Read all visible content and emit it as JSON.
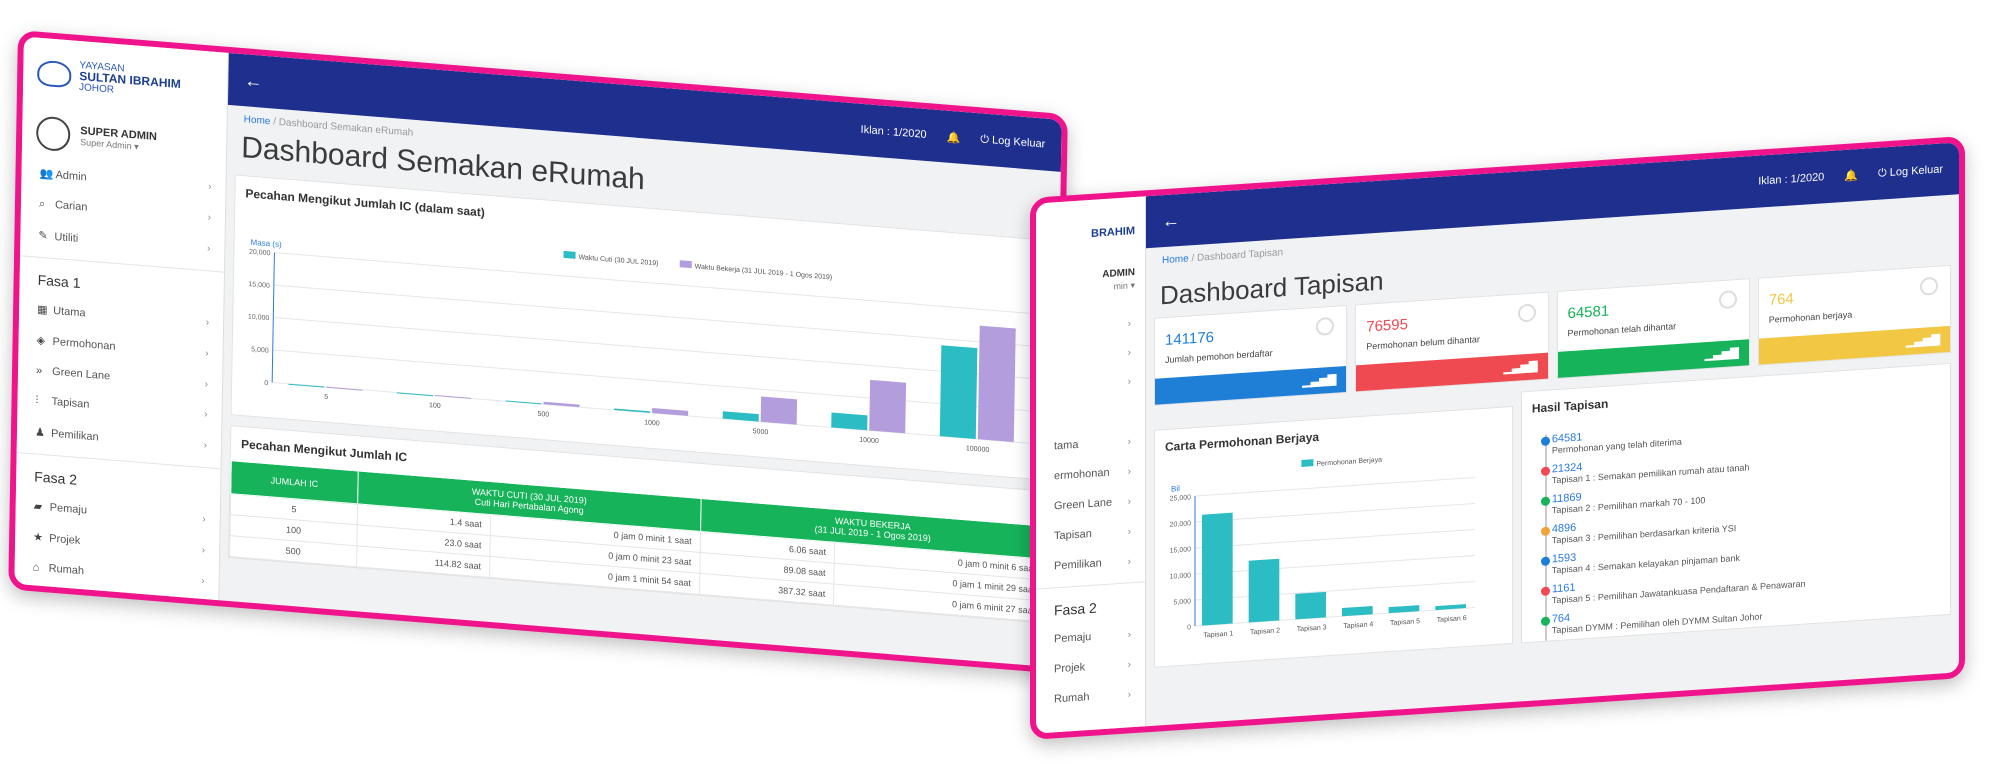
{
  "colors": {
    "accent_pink": "#f0148c",
    "topbar": "#1e2f8e",
    "teal": "#2bbcc4",
    "purple": "#b49ddc",
    "green": "#16b35a",
    "blue": "#1f7fd6",
    "red": "#ef4a52",
    "yellow": "#f2c744"
  },
  "sidebar": {
    "logo": {
      "line1": "YAYASAN",
      "line2": "SULTAN IBRAHIM",
      "line3": "JOHOR"
    },
    "user": {
      "name": "SUPER ADMIN",
      "role": "Super Admin"
    },
    "items_top": [
      {
        "label": "Admin",
        "icon": "users-icon"
      },
      {
        "label": "Carian",
        "icon": "search-icon"
      },
      {
        "label": "Utiliti",
        "icon": "pencil-icon"
      }
    ],
    "fasa1": "Fasa 1",
    "items_fasa1": [
      {
        "label": "Utama",
        "icon": "grid-icon"
      },
      {
        "label": "Permohonan",
        "icon": "layers-icon"
      },
      {
        "label": "Green Lane",
        "icon": "fast-forward-icon"
      },
      {
        "label": "Tapisan",
        "icon": "filter-icon"
      },
      {
        "label": "Pemilikan",
        "icon": "person-icon"
      }
    ],
    "fasa2": "Fasa 2",
    "items_fasa2": [
      {
        "label": "Pemaju",
        "icon": "briefcase-icon"
      },
      {
        "label": "Projek",
        "icon": "star-icon"
      },
      {
        "label": "Rumah",
        "icon": "home-icon"
      }
    ]
  },
  "shot2_sidebar": {
    "logo_part": "BRAHIM",
    "user_part": "ADMIN",
    "role_part": "min",
    "items_fasa1": [
      "tama",
      "ermohonan",
      "Green Lane",
      "Tapisan",
      "Pemilikan"
    ],
    "fasa2": "Fasa 2",
    "items_fasa2": [
      "Pemaju",
      "Projek",
      "Rumah"
    ]
  },
  "topbar": {
    "back": "←",
    "iklan": "Iklan : 1/2020",
    "logout": "Log Keluar"
  },
  "page1": {
    "breadcrumb_home": "Home",
    "breadcrumb_current": "Dashboard Semakan eRumah",
    "title": "Dashboard Semakan eRumah",
    "chart_title": "Pecahan Mengikut Jumlah IC (dalam saat)",
    "table_title": "Pecahan Mengikut Jumlah IC",
    "table": {
      "h_ic": "JUMLAH IC",
      "h_cuti1": "WAKTU CUTI (30 JUL 2019)",
      "h_cuti2": "Cuti Hari Pertabalan Agong",
      "h_kerja1": "WAKTU BEKERJA",
      "h_kerja2": "(31 JUL 2019 - 1 Ogos 2019)",
      "rows": [
        {
          "ic": "5",
          "cuti_s": "1.4 saat",
          "cuti_t": "0 jam 0 minit 1 saat",
          "kerja_s": "6.06 saat",
          "kerja_t": "0 jam 0 minit 6 saat"
        },
        {
          "ic": "100",
          "cuti_s": "23.0 saat",
          "cuti_t": "0 jam 0 minit 23 saat",
          "kerja_s": "89.08 saat",
          "kerja_t": "0 jam 1 minit 29 saat"
        },
        {
          "ic": "500",
          "cuti_s": "114.82 saat",
          "cuti_t": "0 jam 1 minit 54 saat",
          "kerja_s": "387.32 saat",
          "kerja_t": "0 jam 6 minit 27 saat"
        }
      ]
    }
  },
  "page2": {
    "breadcrumb_home": "Home",
    "breadcrumb_current": "Dashboard Tapisan",
    "title": "Dashboard Tapisan",
    "stats": [
      {
        "num": "141176",
        "label": "Jumlah pemohon berdaftar",
        "color": "#1f7fd6"
      },
      {
        "num": "76595",
        "label": "Permohonan belum dihantar",
        "color": "#ef4a52"
      },
      {
        "num": "64581",
        "label": "Permohonan telah dihantar",
        "color": "#16b35a"
      },
      {
        "num": "764",
        "label": "Permohonan berjaya",
        "color": "#f2c744"
      }
    ],
    "carta_title": "Carta Permohonan Berjaya",
    "hasil_title": "Hasil Tapisan",
    "hasil": [
      {
        "num": "64581",
        "desc": "Permohonan yang telah diterima",
        "color": "#1f7fd6"
      },
      {
        "num": "21324",
        "desc": "Tapisan 1 : Semakan pemilikan rumah atau tanah",
        "color": "#ef4a52"
      },
      {
        "num": "11869",
        "desc": "Tapisan 2 : Pemilihan markah 70 - 100",
        "color": "#16b35a"
      },
      {
        "num": "4896",
        "desc": "Tapisan 3 : Pemilihan berdasarkan kriteria YSI",
        "color": "#f2a33a"
      },
      {
        "num": "1593",
        "desc": "Tapisan 4 : Semakan kelayakan pinjaman bank",
        "color": "#1f7fd6"
      },
      {
        "num": "1161",
        "desc": "Tapisan 5 : Pemilihan Jawatankuasa Pendaftaran & Penawaran",
        "color": "#ef4a52"
      },
      {
        "num": "764",
        "desc": "Tapisan DYMM : Pemilihan oleh DYMM Sultan Johor",
        "color": "#16b35a"
      }
    ]
  },
  "chart_data": [
    {
      "type": "bar",
      "title": "Pecahan Mengikut Jumlah IC (dalam saat)",
      "ylabel": "Masa (s)",
      "categories": [
        "5",
        "100",
        "500",
        "1000",
        "5000",
        "10000",
        "100000"
      ],
      "ylim": [
        0,
        20000
      ],
      "yticks": [
        "20,000",
        "15,000",
        "10,000",
        "5,000",
        "0"
      ],
      "legend_position": "top",
      "series": [
        {
          "name": "Waktu Cuti (30 JUL 2019)",
          "color": "#2bbcc4",
          "values": [
            1.4,
            23,
            114.82,
            230,
            1150,
            2300,
            14000
          ]
        },
        {
          "name": "Waktu Bekerja (31 JUL 2019 - 1 Ogos 2019)",
          "color": "#b49ddc",
          "values": [
            6.06,
            89.08,
            387.32,
            780,
            3900,
            7800,
            17500
          ]
        }
      ]
    },
    {
      "type": "bar",
      "title": "Carta Permohonan Berjaya",
      "ylabel": "Bil",
      "categories": [
        "Tapisan 1",
        "Tapisan 2",
        "Tapisan 3",
        "Tapisan 4",
        "Tapisan 5",
        "Tapisan 6"
      ],
      "ylim": [
        0,
        25000
      ],
      "yticks": [
        "25,000",
        "20,000",
        "15,000",
        "10,000",
        "5,000",
        "0"
      ],
      "legend_position": "top",
      "series": [
        {
          "name": "Permohonan Berjaya",
          "color": "#2bbcc4",
          "values": [
            21324,
            11869,
            4896,
            1593,
            1161,
            764
          ]
        }
      ]
    }
  ]
}
